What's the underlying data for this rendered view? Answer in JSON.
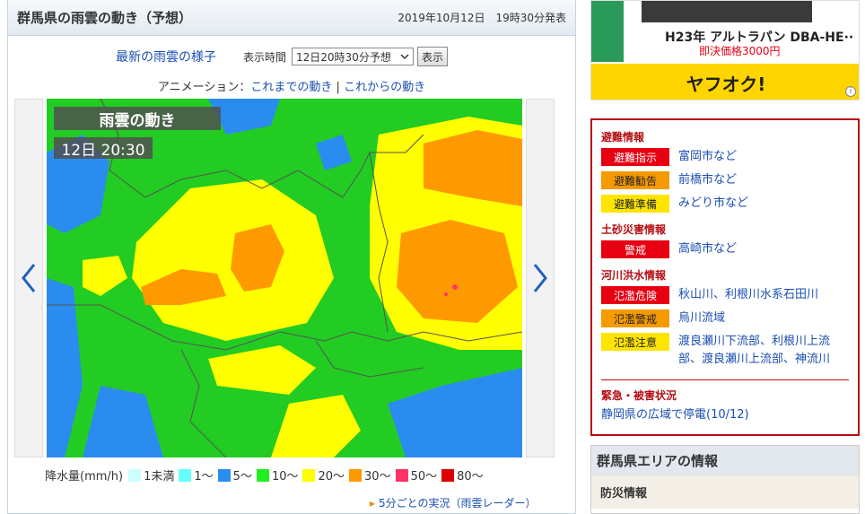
{
  "header": {
    "title": "群馬県の雨雲の動き（予想）",
    "issued": "2019年10月12日　19時30分発表"
  },
  "toolbar": {
    "latest_link": "最新の雨雲の様子",
    "time_label": "表示時間",
    "select_value": "12日20時30分予想",
    "show_button": "表示"
  },
  "animation": {
    "label": "アニメーション：",
    "past": "これまでの動き",
    "sep": "|",
    "future": "これからの動き"
  },
  "map": {
    "overlay_title": "雨雲の動き",
    "overlay_time": "12日 20:30"
  },
  "legend": {
    "label": "降水量(mm/h)",
    "items": [
      {
        "text": "1未満",
        "color": "#ccffff"
      },
      {
        "text": "1〜",
        "color": "#66ffff"
      },
      {
        "text": "5〜",
        "color": "#2b8cf0"
      },
      {
        "text": "10〜",
        "color": "#22ee22"
      },
      {
        "text": "20〜",
        "color": "#ffff00"
      },
      {
        "text": "30〜",
        "color": "#ff9900"
      },
      {
        "text": "50〜",
        "color": "#ff3366"
      },
      {
        "text": "80〜",
        "color": "#dd0000"
      }
    ]
  },
  "more_link": "5分ごとの実況（雨雲レーダー）",
  "ad": {
    "name": "H23年 アルトラパン DBA-HE··",
    "price": "即決価格3000円",
    "logo": "ヤフオク!",
    "info": "i"
  },
  "alerts": {
    "evac_title": "避難情報",
    "evac": [
      {
        "badge": "避難指示",
        "level": "red",
        "place": "富岡市など"
      },
      {
        "badge": "避難勧告",
        "level": "orange",
        "place": "前橋市など"
      },
      {
        "badge": "避難準備",
        "level": "yellow",
        "place": "みどり市など"
      }
    ],
    "landslide_title": "土砂災害情報",
    "landslide": [
      {
        "badge": "警戒",
        "level": "red",
        "place": "高崎市など"
      }
    ],
    "river_title": "河川洪水情報",
    "river": [
      {
        "badge": "氾濫危険",
        "level": "red",
        "place": "秋山川、利根川水系石田川"
      },
      {
        "badge": "氾濫警戒",
        "level": "orange",
        "place": "烏川流域"
      },
      {
        "badge": "氾濫注意",
        "level": "yellow",
        "place": "渡良瀬川下流部、利根川上流部、渡良瀬川上流部、神流川"
      }
    ],
    "emergency_title": "緊急・被害状況",
    "emergency_link": "静岡県の広域で停電(10/12)"
  },
  "area": {
    "title": "群馬県エリアの情報",
    "sub": "防災情報"
  },
  "colors": {
    "alert": "#b50e14",
    "link": "#1a4fb0"
  }
}
